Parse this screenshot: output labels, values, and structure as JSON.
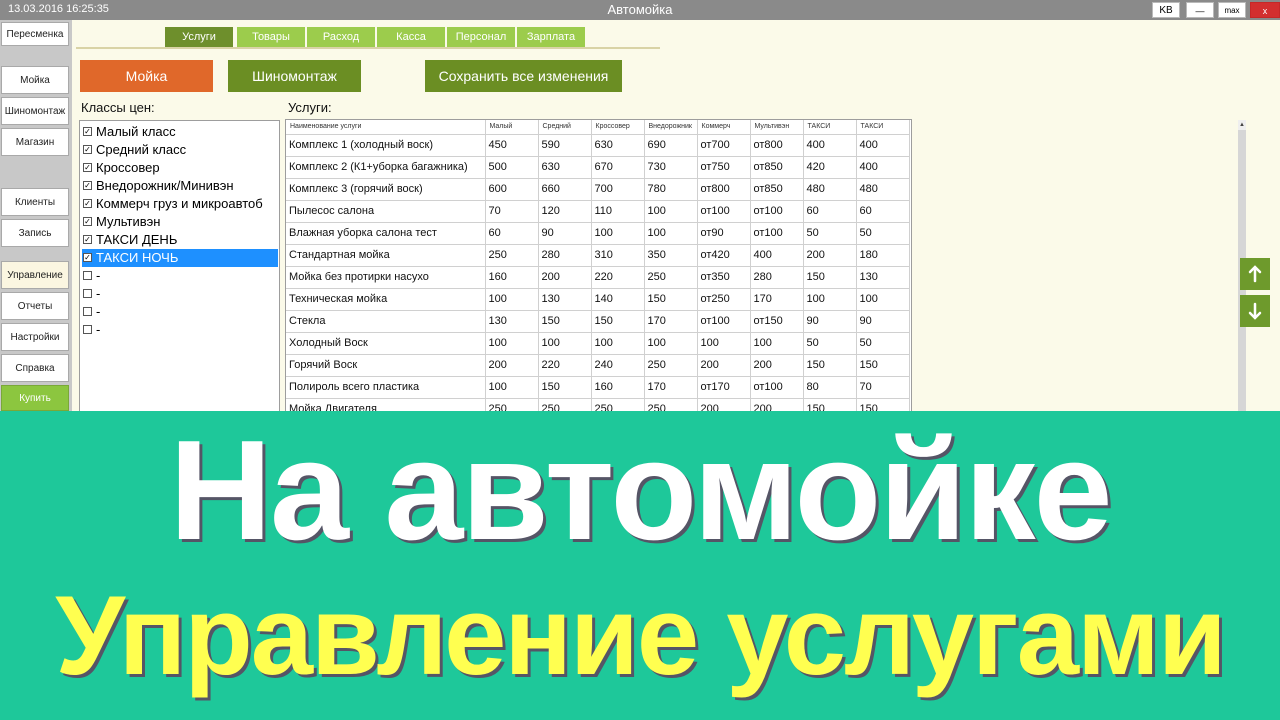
{
  "window": {
    "datetime": "13.03.2016 16:25:35",
    "title": "Автомойка",
    "buttons": {
      "kb": "KB",
      "minimize": "—",
      "maximize": "max",
      "close": "x"
    }
  },
  "nav": {
    "items": [
      {
        "label": "Пересменка"
      },
      {
        "label": "Мойка"
      },
      {
        "label": "Шиномонтаж"
      },
      {
        "label": "Магазин"
      },
      {
        "label": "Клиенты"
      },
      {
        "label": "Запись"
      },
      {
        "label": "Управление"
      },
      {
        "label": "Отчеты"
      },
      {
        "label": "Настройки"
      },
      {
        "label": "Справка"
      },
      {
        "label": "Купить"
      }
    ]
  },
  "tabs": [
    {
      "label": "Услуги",
      "active": true
    },
    {
      "label": "Товары",
      "active": false
    },
    {
      "label": "Расход",
      "active": false
    },
    {
      "label": "Касса",
      "active": false
    },
    {
      "label": "Персонал",
      "active": false
    },
    {
      "label": "Зарплата",
      "active": false
    }
  ],
  "actions": {
    "wash": "Мойка",
    "tire": "Шиномонтаж",
    "save": "Сохранить все изменения"
  },
  "colors": {
    "wash_button": "#e0682a",
    "tire_button": "#6b8e23",
    "save_button": "#6b8e23",
    "banner_bg": "#1ec89a",
    "banner_line2": "#ffff50"
  },
  "price_classes": {
    "title": "Классы цен:",
    "items": [
      {
        "label": "Малый класс",
        "checked": true,
        "selected": false
      },
      {
        "label": "Средний класс",
        "checked": true,
        "selected": false
      },
      {
        "label": "Кроссовер",
        "checked": true,
        "selected": false
      },
      {
        "label": "Внедорожник/Минивэн",
        "checked": true,
        "selected": false
      },
      {
        "label": "Коммерч груз и микроавтоб",
        "checked": true,
        "selected": false
      },
      {
        "label": "Мультивэн",
        "checked": true,
        "selected": false
      },
      {
        "label": "ТАКСИ ДЕНЬ",
        "checked": true,
        "selected": false
      },
      {
        "label": "ТАКСИ НОЧЬ",
        "checked": true,
        "selected": true
      },
      {
        "label": "-",
        "checked": false,
        "selected": false
      },
      {
        "label": "-",
        "checked": false,
        "selected": false
      },
      {
        "label": "-",
        "checked": false,
        "selected": false
      },
      {
        "label": "-",
        "checked": false,
        "selected": false
      }
    ]
  },
  "services": {
    "title": "Услуги:",
    "columns": [
      "Наименование услуги",
      "Малый",
      "Средний",
      "Кроссовер",
      "Внедорожник",
      "Коммерч",
      "Мультивэн",
      "ТАКСИ",
      "ТАКСИ"
    ],
    "rows": [
      [
        "Комплекс 1 (холодный воск)",
        "450",
        "590",
        "630",
        "690",
        "от700",
        "от800",
        "400",
        "400"
      ],
      [
        "Комплекс 2 (К1+уборка багажника)",
        "500",
        "630",
        "670",
        "730",
        "от750",
        "от850",
        "420",
        "400"
      ],
      [
        "Комплекс 3 (горячий воск)",
        "600",
        "660",
        "700",
        "780",
        "от800",
        "от850",
        "480",
        "480"
      ],
      [
        "Пылесос салона",
        "70",
        "120",
        "110",
        "100",
        "от100",
        "от100",
        "60",
        "60"
      ],
      [
        "Влажная уборка салона тест",
        "60",
        "90",
        "100",
        "100",
        "от90",
        "от100",
        "50",
        "50"
      ],
      [
        "Стандартная мойка",
        "250",
        "280",
        "310",
        "350",
        "от420",
        "400",
        "200",
        "180"
      ],
      [
        "Мойка без протирки насухо",
        "160",
        "200",
        "220",
        "250",
        "от350",
        "280",
        "150",
        "130"
      ],
      [
        "Техническая мойка",
        "100",
        "130",
        "140",
        "150",
        "от250",
        "170",
        "100",
        "100"
      ],
      [
        "Стекла",
        "130",
        "150",
        "150",
        "170",
        "от100",
        "от150",
        "90",
        "90"
      ],
      [
        "Холодный Воск",
        "100",
        "100",
        "100",
        "100",
        "100",
        "100",
        "50",
        "50"
      ],
      [
        "Горячий Воск",
        "200",
        "220",
        "240",
        "250",
        "200",
        "200",
        "150",
        "150"
      ],
      [
        "Полироль всего пластика",
        "100",
        "150",
        "160",
        "170",
        "от170",
        "от100",
        "80",
        "70"
      ],
      [
        "Мойка Двигателя",
        "250",
        "250",
        "250",
        "250",
        "200",
        "200",
        "150",
        "150"
      ]
    ]
  },
  "banner": {
    "line1": "На автомойке",
    "line2": "Управление услугами"
  }
}
